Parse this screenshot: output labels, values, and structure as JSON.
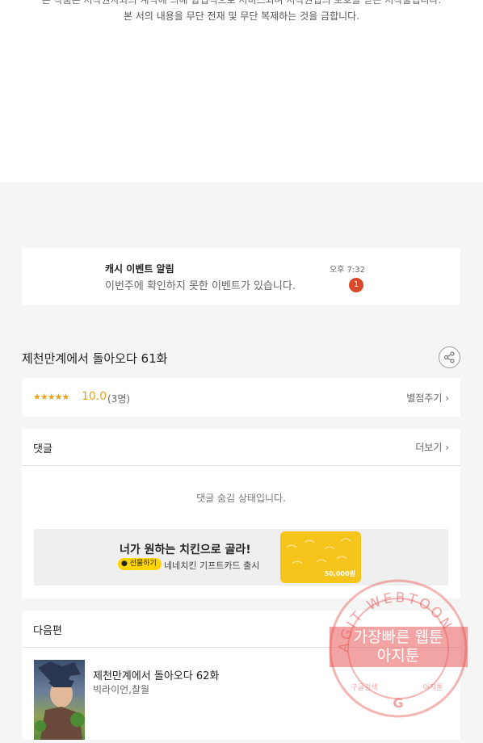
{
  "copyright": {
    "line1": "본 작품은 저작권자와의 계약에 의해 합법적으로 서비스되며 저작권법의 보호를 받는 저작물입니다.",
    "line2": "본 서의 내용을 무단 전재 및 무단 복제하는 것을 금합니다."
  },
  "notification": {
    "title": "캐시 이벤트 알림",
    "body": "이번주에 확인하지 못한 이벤트가 있습니다.",
    "time": "오후 7:32",
    "badge": "1"
  },
  "episode": {
    "title": "제천만계에서 돌아오다 61화"
  },
  "rating": {
    "stars": "★★★★★",
    "score": "10.0",
    "count": "(3명)",
    "rate_link": "별점주기 ›"
  },
  "comments": {
    "heading": "댓글",
    "more": "더보기 ›",
    "hidden_message": "댓글 숨김 상태입니다."
  },
  "ad": {
    "headline": "너가 원하는 치킨으로 골라!",
    "pill": "● 선물하기",
    "subline": "네네치킨 기프트카드 출시",
    "card_amount": "50,000원"
  },
  "next": {
    "heading": "다음편",
    "title": "제천만계에서 돌아오다 62화",
    "author": "빅라이언,찰월"
  },
  "watermark": {
    "ring_text": "AGIT WEBTOON",
    "line1": "가장빠른 웹툰",
    "line2": "아지툰",
    "bottom_left": "구글검색",
    "bottom_right": "아지툰"
  },
  "colors": {
    "accent_star": "#e8a31a",
    "badge": "#d9482b",
    "ad_yellow": "#ffd400",
    "stamp": "#e85a5a"
  }
}
